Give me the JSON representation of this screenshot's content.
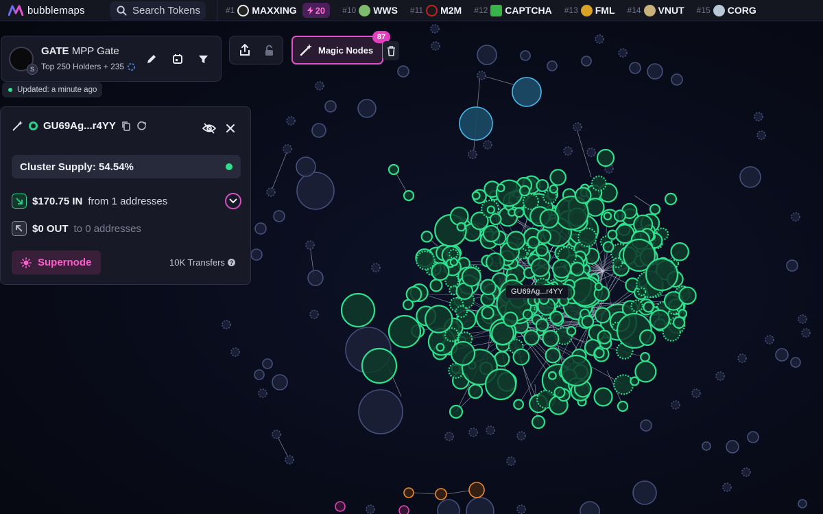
{
  "app": {
    "name": "bubblemaps"
  },
  "search": {
    "label": "Search Tokens"
  },
  "ticker": [
    {
      "rank": "#1",
      "name": "MAXXING",
      "boost": "20",
      "icon_color": "#e8e8e8"
    },
    {
      "rank": "#10",
      "name": "WWS",
      "icon_color": "#7dbb6a"
    },
    {
      "rank": "#11",
      "name": "M2M",
      "icon_color": "#c42020"
    },
    {
      "rank": "#12",
      "name": "CAPTCHA",
      "icon_color": "#38b34a"
    },
    {
      "rank": "#13",
      "name": "FML",
      "icon_color": "#d9a227"
    },
    {
      "rank": "#14",
      "name": "VNUT",
      "icon_color": "#c9b27a"
    },
    {
      "rank": "#15",
      "name": "CORG",
      "icon_color": "#b8c8d8"
    }
  ],
  "token": {
    "symbol": "GATE",
    "name": "MPP Gate",
    "subtitle": "Top 250 Holders + 235",
    "chain_badge": "S",
    "updated": "Updated: a minute ago"
  },
  "magic_nodes": {
    "label": "Magic Nodes",
    "count": "87"
  },
  "detail": {
    "address": "GU69Ag...r4YY",
    "cluster_supply": "Cluster Supply: 54.54%",
    "in_amount": "$170.75 IN",
    "in_desc": "from 1 addresses",
    "out_amount": "$0 OUT",
    "out_desc": "to 0 addresses",
    "supernode_label": "Supernode",
    "transfers": "10K Transfers"
  },
  "tooltip": {
    "label": "GU69Ag...r4YY"
  },
  "colors": {
    "cluster_green": "#2ee08e",
    "blue_node": "#3aa6d6",
    "gray_node": "#3a4462",
    "orange_node": "#f08a2c",
    "magenta_node": "#e83fbf",
    "accent_pink": "#e052c6"
  }
}
